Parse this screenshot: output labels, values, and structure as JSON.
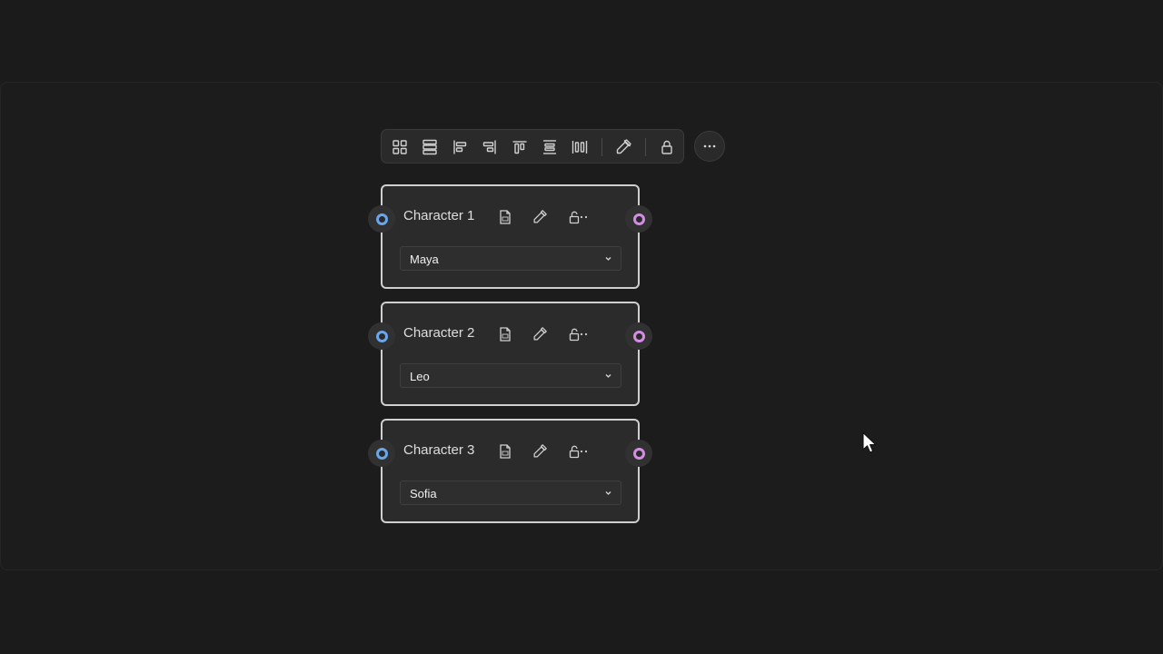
{
  "toolbar": {
    "buttons": [
      {
        "name": "grid-layout-icon"
      },
      {
        "name": "stack-layout-icon"
      },
      {
        "name": "align-left-icon"
      },
      {
        "name": "align-right-icon"
      },
      {
        "name": "align-top-icon"
      },
      {
        "name": "align-middle-icon"
      },
      {
        "name": "distribute-horizontal-icon"
      },
      {
        "name": "color-picker-icon"
      },
      {
        "name": "lock-icon"
      }
    ],
    "more": "more-icon"
  },
  "nodes": [
    {
      "title": "Character 1",
      "value": "Maya"
    },
    {
      "title": "Character 2",
      "value": "Leo"
    },
    {
      "title": "Character 3",
      "value": "Sofia"
    }
  ],
  "colors": {
    "input_port": "#6aa6ea",
    "output_port": "#d58ce6",
    "node_border": "#cfcfcf",
    "background": "#1b1b1b"
  }
}
